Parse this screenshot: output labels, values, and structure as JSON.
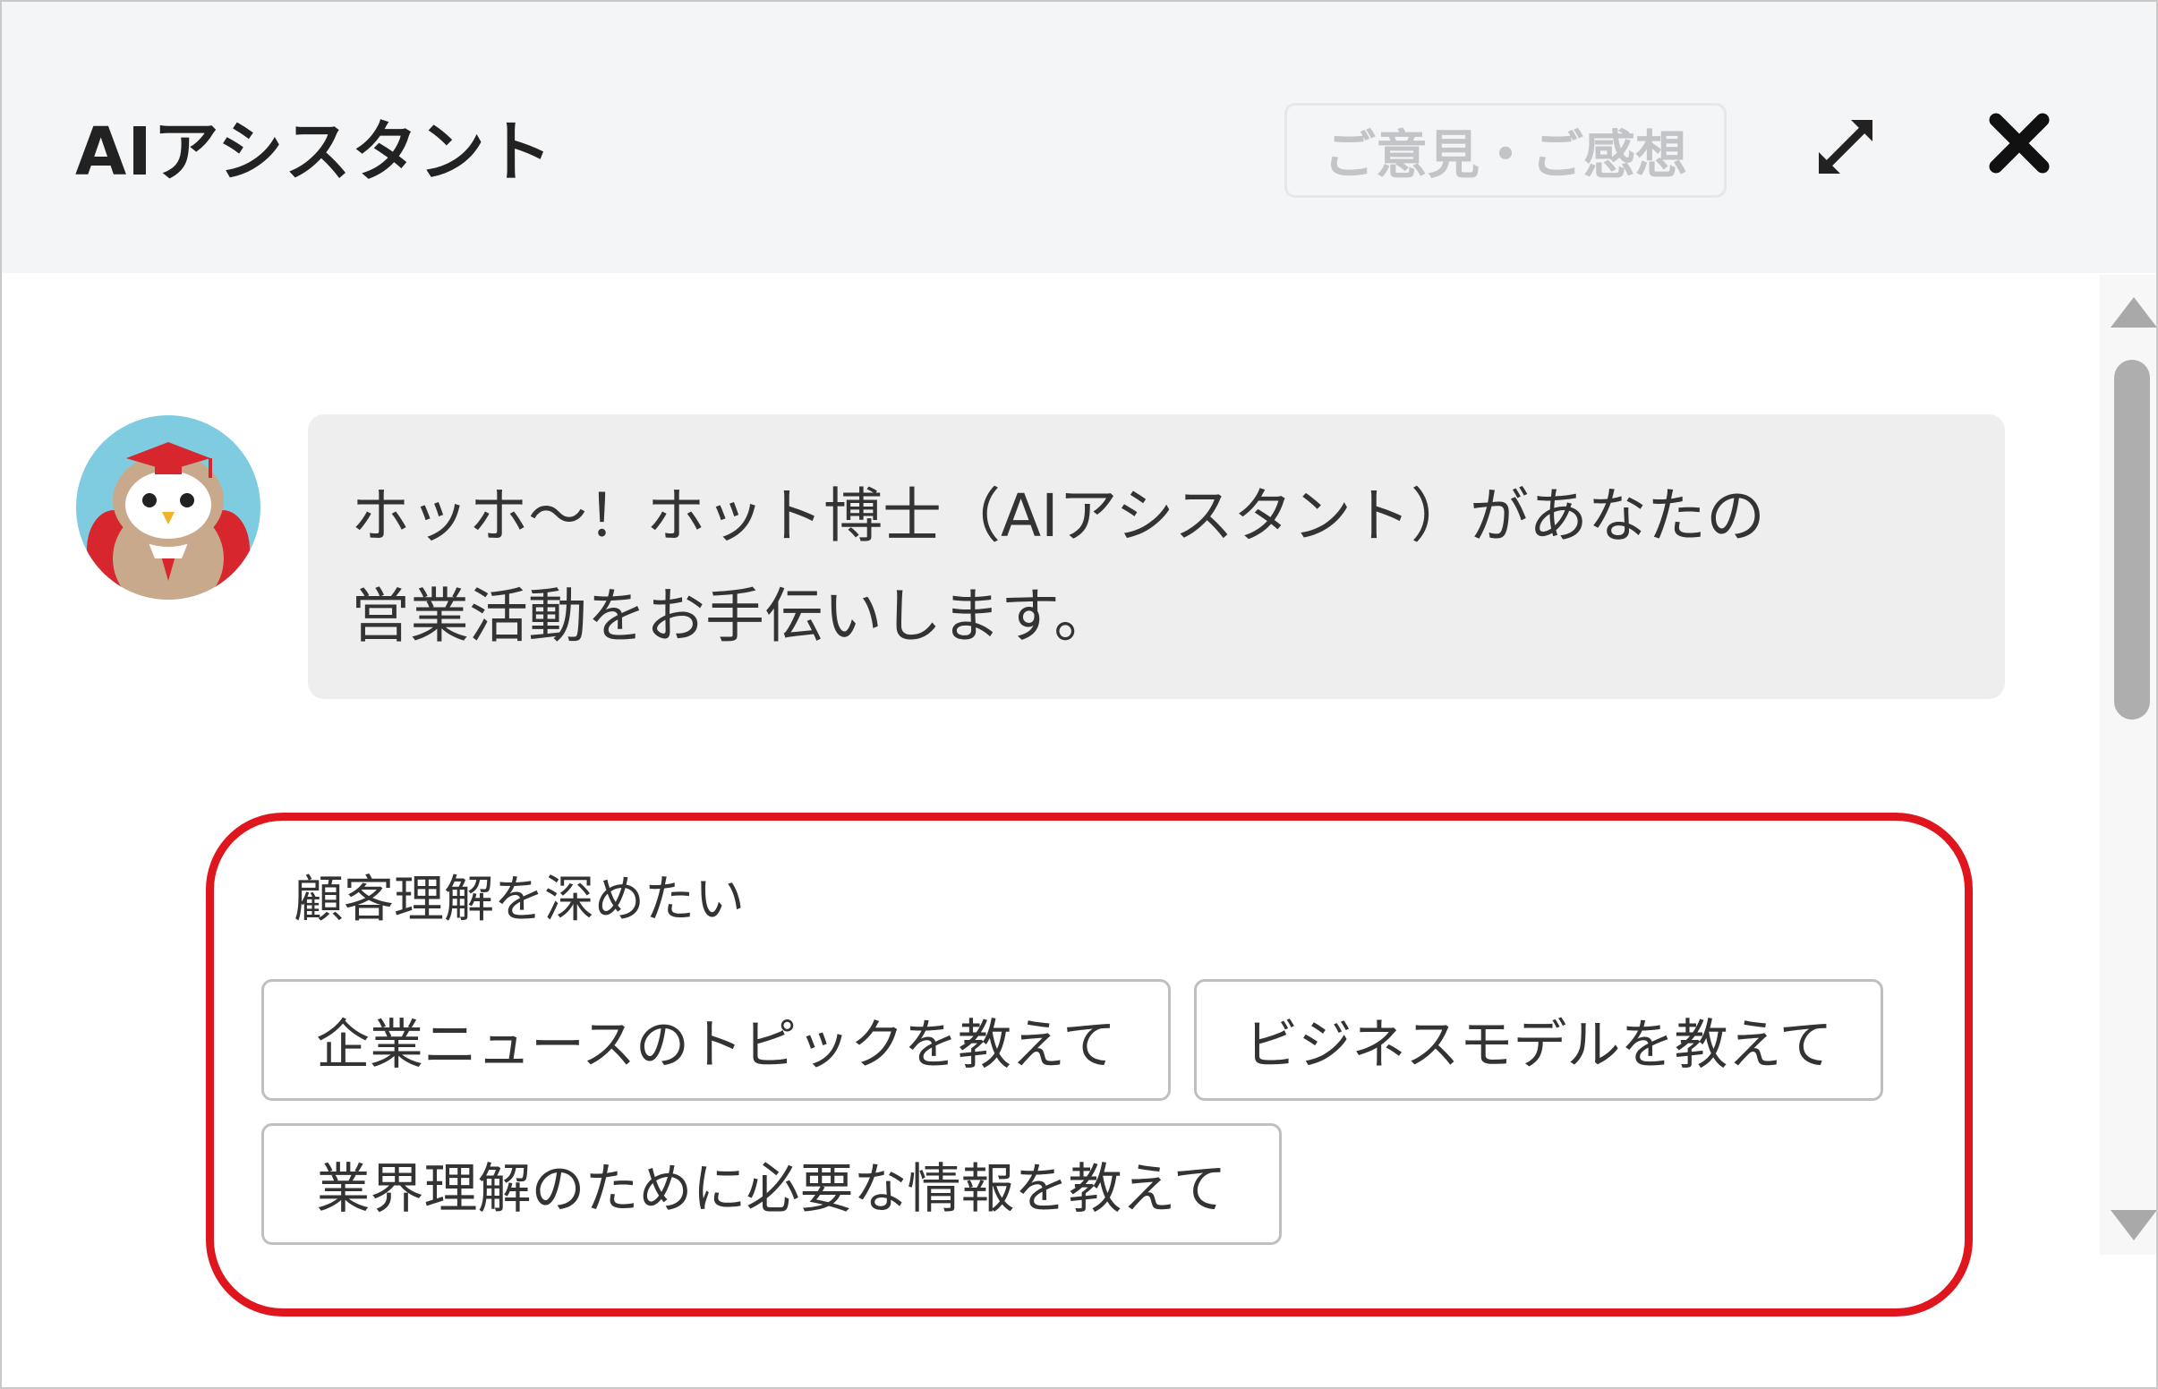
{
  "header": {
    "title": "AIアシスタント",
    "feedback_label": "ご意見・ご感想",
    "expand_icon": "expand-arrows-icon",
    "close_icon": "close-icon"
  },
  "chat": {
    "assistant_avatar": "owl-professor-avatar",
    "message_lines": [
      "ホッホ～！ホット博士（AIアシスタント）があなたの",
      "営業活動をお手伝いします。"
    ]
  },
  "suggestions": {
    "category": "顧客理解を深めたい",
    "items": [
      "企業ニュースのトピックを教えて",
      "ビジネスモデルを教えて",
      "業界理解のために必要な情報を教えて"
    ]
  },
  "colors": {
    "header_bg": "#f4f5f7",
    "bubble_bg": "#eeeeee",
    "highlight_border": "#e0161e",
    "text": "#333333"
  }
}
